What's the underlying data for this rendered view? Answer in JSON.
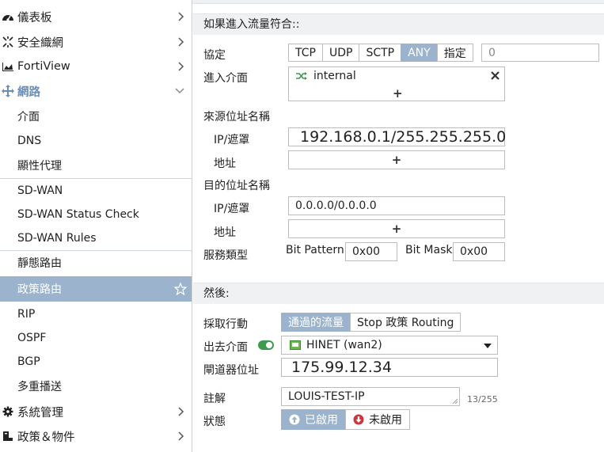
{
  "sidebar": {
    "items": [
      {
        "label": "儀表板"
      },
      {
        "label": "安全織網"
      },
      {
        "label": "FortiView"
      },
      {
        "label": "網路"
      },
      {
        "label": "介面"
      },
      {
        "label": "DNS"
      },
      {
        "label": "顯性代理"
      },
      {
        "label": "SD-WAN"
      },
      {
        "label": "SD-WAN Status Check"
      },
      {
        "label": "SD-WAN Rules"
      },
      {
        "label": "靜態路由"
      },
      {
        "label": "政策路由"
      },
      {
        "label": "RIP"
      },
      {
        "label": "OSPF"
      },
      {
        "label": "BGP"
      },
      {
        "label": "多重播送"
      },
      {
        "label": "系統管理"
      },
      {
        "label": "政策＆物件"
      }
    ]
  },
  "match": {
    "section_title": "如果進入流量符合::",
    "protocol_label": "協定",
    "protocol_options": [
      "TCP",
      "UDP",
      "SCTP",
      "ANY",
      "指定"
    ],
    "protocol_selected": "ANY",
    "protocol_number": "0",
    "incoming_iface_label": "進入介面",
    "incoming_iface_value": "internal",
    "source_label": "來源位址名稱",
    "src_ip_label": "IP/遮罩",
    "src_ip_value": "192.168.0.1/255.255.255.0",
    "src_addr_label": "地址",
    "dest_label": "目的位址名稱",
    "dst_ip_label": "IP/遮罩",
    "dst_ip_value": "0.0.0.0/0.0.0.0",
    "dst_addr_label": "地址",
    "service_label": "服務類型",
    "bit_pattern_label": "Bit Pattern",
    "bit_pattern_value": "0x00",
    "bit_mask_label": "Bit Mask",
    "bit_mask_value": "0x00"
  },
  "then": {
    "section_title": "然後:",
    "action_label": "採取行動",
    "action_options": [
      "通過的流量",
      "Stop 政策 Routing"
    ],
    "action_selected": "通過的流量",
    "outgoing_label": "出去介面",
    "outgoing_value": "HINET (wan2)",
    "gateway_label": "閘道器位址",
    "gateway_value": "175.99.12.34",
    "comment_label": "註解",
    "comment_value": "LOUIS-TEST-IP",
    "comment_counter": "13/255",
    "status_label": "狀態",
    "status_enabled": "已啟用",
    "status_disabled": "未啟用"
  },
  "colors": {
    "accent": "#9bb3cd",
    "section_active": "#6c8eb4",
    "toggle_on": "#3d9a4e",
    "disabled_red": "#d0343a"
  }
}
